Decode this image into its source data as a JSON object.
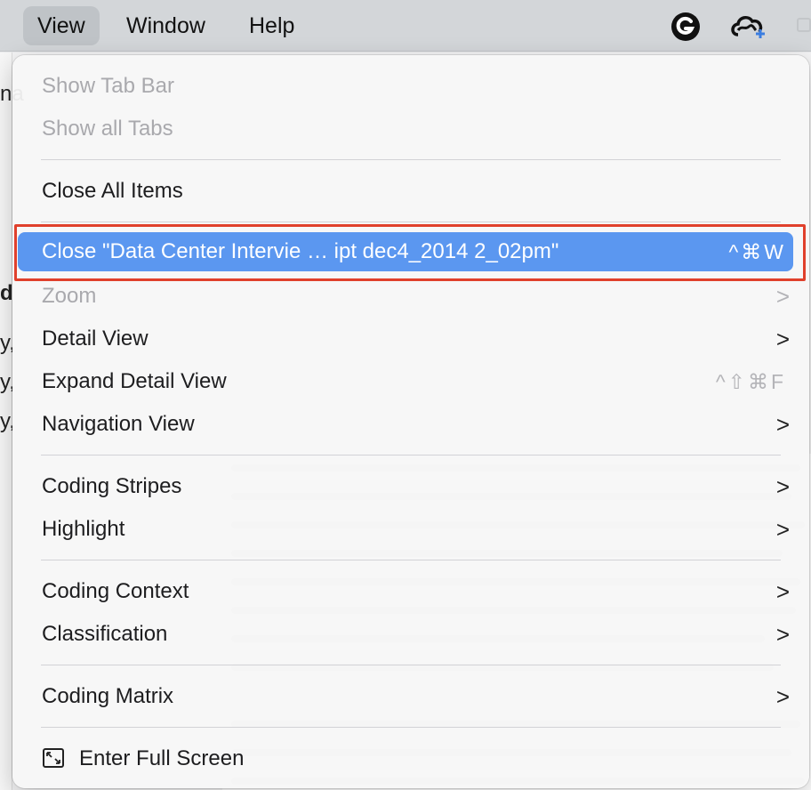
{
  "menubar": {
    "items": [
      {
        "label": "View",
        "active": true
      },
      {
        "label": "Window",
        "active": false
      },
      {
        "label": "Help",
        "active": false
      }
    ],
    "tray_icons": [
      "grammarly-icon",
      "creative-cloud-icon"
    ]
  },
  "background": {
    "edge_texts": [
      "na",
      "d",
      "y,",
      "y,",
      "y,"
    ]
  },
  "view_menu": {
    "items": [
      {
        "label": "Show Tab Bar",
        "disabled": true
      },
      {
        "label": "Show all Tabs",
        "disabled": true
      },
      {
        "label": "Close All Items"
      },
      {
        "label": "Close \"Data Center Intervie … ipt dec4_2014 2_02pm\"",
        "shortcut": "^⌘W",
        "highlighted": true
      },
      {
        "label": "Zoom",
        "disabled": true,
        "submenu": true
      },
      {
        "label": "Detail View",
        "submenu": true
      },
      {
        "label": "Expand Detail View",
        "shortcut": "^⇧⌘F"
      },
      {
        "label": "Navigation View",
        "submenu": true
      },
      {
        "label": "Coding Stripes",
        "submenu": true
      },
      {
        "label": "Highlight",
        "submenu": true
      },
      {
        "label": "Coding Context",
        "submenu": true
      },
      {
        "label": "Classification",
        "submenu": true
      },
      {
        "label": "Coding Matrix",
        "submenu": true
      },
      {
        "label": "Enter Full Screen",
        "icon": "fullscreen-icon"
      }
    ],
    "submenu_glyph": ">"
  },
  "colors": {
    "highlight": "#5b97f0",
    "annotation_box": "#e0402c"
  }
}
